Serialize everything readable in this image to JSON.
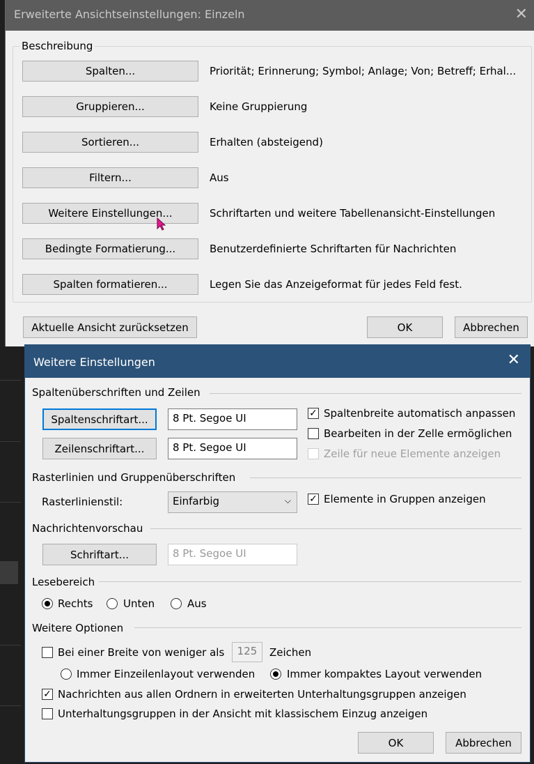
{
  "dialog1": {
    "title": "Erweiterte Ansichtseinstellungen: Einzeln",
    "group_label": "Beschreibung",
    "rows": [
      {
        "button": "Spalten...",
        "description": "Priorität; Erinnerung; Symbol; Anlage; Von; Betreff; Erhal..."
      },
      {
        "button": "Gruppieren...",
        "description": "Keine Gruppierung"
      },
      {
        "button": "Sortieren...",
        "description": "Erhalten (absteigend)"
      },
      {
        "button": "Filtern...",
        "description": "Aus"
      },
      {
        "button": "Weitere Einstellungen...",
        "description": "Schriftarten und weitere Tabellenansicht-Einstellungen"
      },
      {
        "button": "Bedingte Formatierung...",
        "description": "Benutzerdefinierte Schriftarten für Nachrichten"
      },
      {
        "button": "Spalten formatieren...",
        "description": "Legen Sie das Anzeigeformat für jedes Feld fest."
      }
    ],
    "reset_button": "Aktuelle Ansicht zurücksetzen",
    "ok_button": "OK",
    "cancel_button": "Abbrechen"
  },
  "dialog2": {
    "title": "Weitere Einstellungen",
    "columns_section": {
      "heading": "Spaltenüberschriften und Zeilen",
      "column_font_button": "Spaltenschriftart...",
      "column_font_value": "8 Pt. Segoe UI",
      "row_font_button": "Zeilenschriftart...",
      "row_font_value": "8 Pt. Segoe UI",
      "auto_width_label": "Spaltenbreite automatisch anpassen",
      "auto_width_checked": true,
      "in_cell_edit_label": "Bearbeiten in der Zelle ermöglichen",
      "in_cell_edit_checked": false,
      "new_item_row_label": "Zeile für neue Elemente anzeigen",
      "new_item_row_checked": false
    },
    "grid_section": {
      "heading": "Rasterlinien und Gruppenüberschriften",
      "style_label": "Rasterlinienstil:",
      "style_value": "Einfarbig",
      "show_in_groups_label": "Elemente in Gruppen anzeigen",
      "show_in_groups_checked": true
    },
    "preview_section": {
      "heading": "Nachrichtenvorschau",
      "font_button": "Schriftart...",
      "font_value": "8 Pt. Segoe UI"
    },
    "reading_pane": {
      "heading": "Lesebereich",
      "options": [
        "Rechts",
        "Unten",
        "Aus"
      ],
      "selected": "Rechts"
    },
    "other_options": {
      "heading": "Weitere Optionen",
      "width_label_before": "Bei einer Breite von weniger als",
      "width_value": "125",
      "width_label_after": "Zeichen",
      "width_checked": false,
      "single_line_label": "Immer Einzeilenlayout verwenden",
      "compact_label": "Immer kompaktes Layout verwenden",
      "layout_selected": "compact",
      "all_folders_label": "Nachrichten aus allen Ordnern in erweiterten Unterhaltungsgruppen anzeigen",
      "all_folders_checked": true,
      "classic_indent_label": "Unterhaltungsgruppen in der Ansicht mit klassischem Einzug anzeigen",
      "classic_indent_checked": false
    },
    "ok_button": "OK",
    "cancel_button": "Abbrechen"
  },
  "colors": {
    "dialog1_titlebar": "#5c5c5c",
    "dialog2_titlebar": "#2b5278",
    "focus": "#0078d7",
    "cursor": "#e0198c"
  }
}
